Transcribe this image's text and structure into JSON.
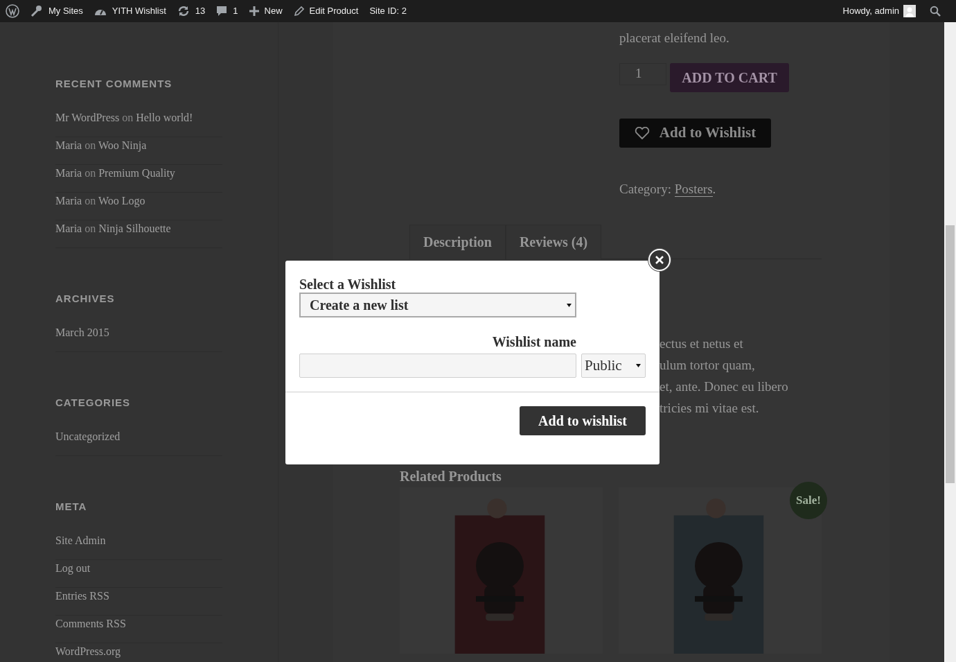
{
  "admin_bar": {
    "items": [
      {
        "kind": "logo"
      },
      {
        "kind": "sites",
        "label": "My Sites"
      },
      {
        "kind": "dashboard",
        "label": "YITH Wishlist"
      },
      {
        "kind": "updates",
        "label": "13"
      },
      {
        "kind": "comments",
        "label": "1"
      },
      {
        "kind": "new",
        "label": "New"
      },
      {
        "kind": "edit",
        "label": "Edit Product"
      },
      {
        "kind": "text",
        "label": "Site ID: 2"
      }
    ],
    "greeting": "Howdy, admin"
  },
  "sidebar": [
    {
      "title": "RECENT COMMENTS",
      "items": [
        {
          "author": "Mr WordPress",
          "connector": "on",
          "post": "Hello world!"
        },
        {
          "author": "Maria",
          "connector": "on",
          "post": "Woo Ninja"
        },
        {
          "author": "Maria",
          "connector": "on",
          "post": "Premium Quality"
        },
        {
          "author": "Maria",
          "connector": "on",
          "post": "Woo Logo"
        },
        {
          "author": "Maria",
          "connector": "on",
          "post": "Ninja Silhouette"
        }
      ]
    },
    {
      "title": "ARCHIVES",
      "items": [
        {
          "post": "March 2015"
        }
      ]
    },
    {
      "title": "CATEGORIES",
      "items": [
        {
          "post": "Uncategorized"
        }
      ]
    },
    {
      "title": "META",
      "items": [
        {
          "post": "Site Admin"
        },
        {
          "post": "Log out"
        },
        {
          "post": "Entries RSS"
        },
        {
          "post": "Comments RSS"
        },
        {
          "post": "WordPress.org"
        }
      ]
    }
  ],
  "product": {
    "summary_tail": "placerat eleifend leo.",
    "quantity": "1",
    "add_to_cart": "ADD TO CART",
    "add_to_wishlist": "Add to Wishlist",
    "category_label": "Category:",
    "category": "Posters",
    "category_end": "."
  },
  "tabs": [
    {
      "label": "Description"
    },
    {
      "label": "Reviews (4)"
    }
  ],
  "description_lines": [
    "ectus et netus et",
    "ulum tortor quam,",
    "et, ante. Donec eu libero",
    "tricies mi vitae est."
  ],
  "related": {
    "title": "Related Products",
    "products": [
      {
        "kind": "picture"
      },
      {
        "kind": "picture",
        "badge": "Sale!"
      }
    ]
  },
  "modal": {
    "select_label": "Select a Wishlist",
    "select_value": "Create a new list",
    "name_label": "Wishlist name",
    "visibility": "Public",
    "submit": "Add to wishlist"
  }
}
